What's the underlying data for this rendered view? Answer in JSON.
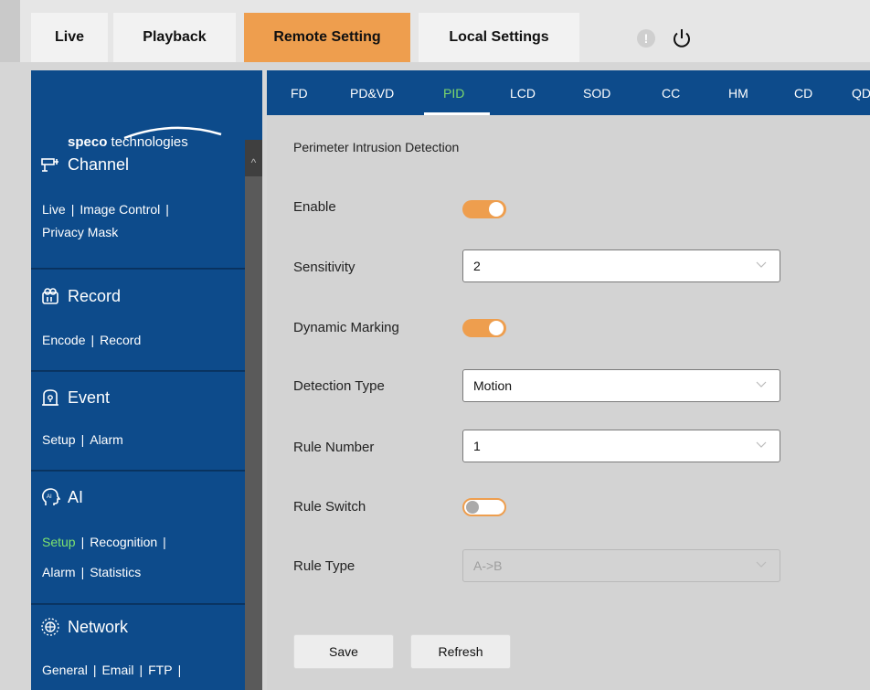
{
  "top_nav": {
    "tabs": [
      {
        "label": "Live"
      },
      {
        "label": "Playback"
      },
      {
        "label": "Remote Setting"
      },
      {
        "label": "Local Settings"
      }
    ],
    "active_tab": "Remote Setting",
    "alert_glyph": "!",
    "colors": {
      "active_tab": "#ee9e4e",
      "tab": "#f2f2f2"
    }
  },
  "sidebar": {
    "logo": {
      "bold": "speco",
      "rest": " technologies"
    },
    "sections": [
      {
        "title": "Channel",
        "icon": "camera-icon",
        "links": [
          "Live",
          "Image Control",
          "Privacy Mask"
        ]
      },
      {
        "title": "Record",
        "icon": "record-icon",
        "links": [
          "Encode",
          "Record"
        ]
      },
      {
        "title": "Event",
        "icon": "alarm-bell-icon",
        "links": [
          "Setup",
          "Alarm"
        ]
      },
      {
        "title": "AI",
        "icon": "ai-head-icon",
        "links": [
          "Setup",
          "Recognition",
          "Alarm",
          "Statistics"
        ],
        "active_link": "Setup"
      },
      {
        "title": "Network",
        "icon": "network-globe-icon",
        "links": [
          "General",
          "Email",
          "FTP"
        ]
      }
    ],
    "colors": {
      "background": "#0d4b8b",
      "active_link": "#7ee46e"
    }
  },
  "subtabs": {
    "items": [
      "FD",
      "PD&VD",
      "PID",
      "LCD",
      "SOD",
      "CC",
      "HM",
      "CD",
      "QD"
    ],
    "active": "PID"
  },
  "form": {
    "section_title": "Perimeter Intrusion Detection",
    "enable": {
      "label": "Enable",
      "value": true
    },
    "sensitivity": {
      "label": "Sensitivity",
      "value": "2"
    },
    "dynamic_marking": {
      "label": "Dynamic Marking",
      "value": true
    },
    "detection_type": {
      "label": "Detection Type",
      "value": "Motion"
    },
    "rule_number": {
      "label": "Rule Number",
      "value": "1"
    },
    "rule_switch": {
      "label": "Rule Switch",
      "value": false
    },
    "rule_type": {
      "label": "Rule Type",
      "value": "A->B",
      "disabled": true
    }
  },
  "buttons": {
    "save": "Save",
    "refresh": "Refresh"
  }
}
